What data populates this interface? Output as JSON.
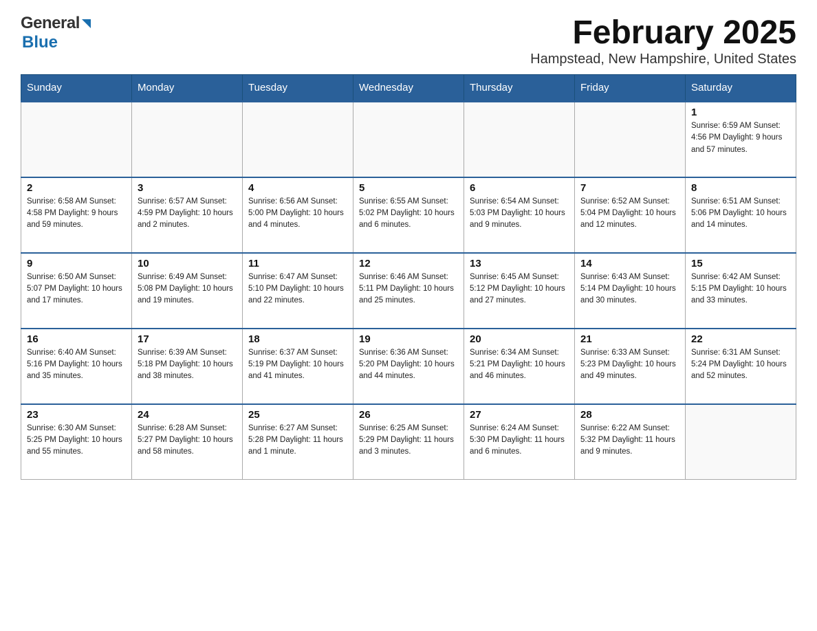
{
  "logo": {
    "general": "General",
    "blue": "Blue"
  },
  "title": {
    "month": "February 2025",
    "location": "Hampstead, New Hampshire, United States"
  },
  "weekdays": [
    "Sunday",
    "Monday",
    "Tuesday",
    "Wednesday",
    "Thursday",
    "Friday",
    "Saturday"
  ],
  "weeks": [
    [
      {
        "day": "",
        "info": ""
      },
      {
        "day": "",
        "info": ""
      },
      {
        "day": "",
        "info": ""
      },
      {
        "day": "",
        "info": ""
      },
      {
        "day": "",
        "info": ""
      },
      {
        "day": "",
        "info": ""
      },
      {
        "day": "1",
        "info": "Sunrise: 6:59 AM\nSunset: 4:56 PM\nDaylight: 9 hours and 57 minutes."
      }
    ],
    [
      {
        "day": "2",
        "info": "Sunrise: 6:58 AM\nSunset: 4:58 PM\nDaylight: 9 hours and 59 minutes."
      },
      {
        "day": "3",
        "info": "Sunrise: 6:57 AM\nSunset: 4:59 PM\nDaylight: 10 hours and 2 minutes."
      },
      {
        "day": "4",
        "info": "Sunrise: 6:56 AM\nSunset: 5:00 PM\nDaylight: 10 hours and 4 minutes."
      },
      {
        "day": "5",
        "info": "Sunrise: 6:55 AM\nSunset: 5:02 PM\nDaylight: 10 hours and 6 minutes."
      },
      {
        "day": "6",
        "info": "Sunrise: 6:54 AM\nSunset: 5:03 PM\nDaylight: 10 hours and 9 minutes."
      },
      {
        "day": "7",
        "info": "Sunrise: 6:52 AM\nSunset: 5:04 PM\nDaylight: 10 hours and 12 minutes."
      },
      {
        "day": "8",
        "info": "Sunrise: 6:51 AM\nSunset: 5:06 PM\nDaylight: 10 hours and 14 minutes."
      }
    ],
    [
      {
        "day": "9",
        "info": "Sunrise: 6:50 AM\nSunset: 5:07 PM\nDaylight: 10 hours and 17 minutes."
      },
      {
        "day": "10",
        "info": "Sunrise: 6:49 AM\nSunset: 5:08 PM\nDaylight: 10 hours and 19 minutes."
      },
      {
        "day": "11",
        "info": "Sunrise: 6:47 AM\nSunset: 5:10 PM\nDaylight: 10 hours and 22 minutes."
      },
      {
        "day": "12",
        "info": "Sunrise: 6:46 AM\nSunset: 5:11 PM\nDaylight: 10 hours and 25 minutes."
      },
      {
        "day": "13",
        "info": "Sunrise: 6:45 AM\nSunset: 5:12 PM\nDaylight: 10 hours and 27 minutes."
      },
      {
        "day": "14",
        "info": "Sunrise: 6:43 AM\nSunset: 5:14 PM\nDaylight: 10 hours and 30 minutes."
      },
      {
        "day": "15",
        "info": "Sunrise: 6:42 AM\nSunset: 5:15 PM\nDaylight: 10 hours and 33 minutes."
      }
    ],
    [
      {
        "day": "16",
        "info": "Sunrise: 6:40 AM\nSunset: 5:16 PM\nDaylight: 10 hours and 35 minutes."
      },
      {
        "day": "17",
        "info": "Sunrise: 6:39 AM\nSunset: 5:18 PM\nDaylight: 10 hours and 38 minutes."
      },
      {
        "day": "18",
        "info": "Sunrise: 6:37 AM\nSunset: 5:19 PM\nDaylight: 10 hours and 41 minutes."
      },
      {
        "day": "19",
        "info": "Sunrise: 6:36 AM\nSunset: 5:20 PM\nDaylight: 10 hours and 44 minutes."
      },
      {
        "day": "20",
        "info": "Sunrise: 6:34 AM\nSunset: 5:21 PM\nDaylight: 10 hours and 46 minutes."
      },
      {
        "day": "21",
        "info": "Sunrise: 6:33 AM\nSunset: 5:23 PM\nDaylight: 10 hours and 49 minutes."
      },
      {
        "day": "22",
        "info": "Sunrise: 6:31 AM\nSunset: 5:24 PM\nDaylight: 10 hours and 52 minutes."
      }
    ],
    [
      {
        "day": "23",
        "info": "Sunrise: 6:30 AM\nSunset: 5:25 PM\nDaylight: 10 hours and 55 minutes."
      },
      {
        "day": "24",
        "info": "Sunrise: 6:28 AM\nSunset: 5:27 PM\nDaylight: 10 hours and 58 minutes."
      },
      {
        "day": "25",
        "info": "Sunrise: 6:27 AM\nSunset: 5:28 PM\nDaylight: 11 hours and 1 minute."
      },
      {
        "day": "26",
        "info": "Sunrise: 6:25 AM\nSunset: 5:29 PM\nDaylight: 11 hours and 3 minutes."
      },
      {
        "day": "27",
        "info": "Sunrise: 6:24 AM\nSunset: 5:30 PM\nDaylight: 11 hours and 6 minutes."
      },
      {
        "day": "28",
        "info": "Sunrise: 6:22 AM\nSunset: 5:32 PM\nDaylight: 11 hours and 9 minutes."
      },
      {
        "day": "",
        "info": ""
      }
    ]
  ]
}
